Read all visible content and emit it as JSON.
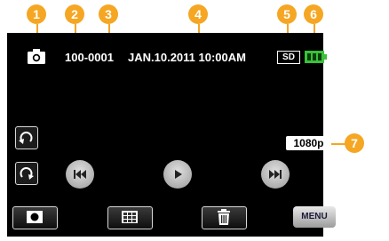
{
  "callouts": [
    "1",
    "2",
    "3",
    "4",
    "5",
    "6",
    "7"
  ],
  "info": {
    "folder": "100-0001",
    "datetime": "JAN.10.2011 10:00AM",
    "media": "SD",
    "resolution": "1080p"
  },
  "controls": {
    "menu_label": "MENU"
  },
  "icons": [
    "camera-mode-icon",
    "battery-icon",
    "rotate-left-icon",
    "rotate-right-icon",
    "previous-icon",
    "play-icon",
    "next-icon",
    "record-icon",
    "index-icon",
    "trash-icon"
  ],
  "colors": {
    "callout": "#f5a623",
    "battery": "#39c23a",
    "screen": "#000000"
  }
}
